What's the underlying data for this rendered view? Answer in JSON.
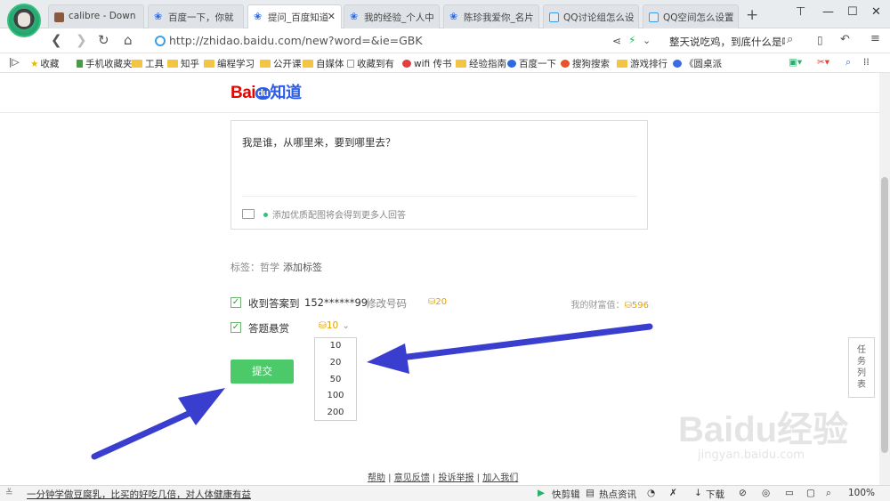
{
  "browser": {
    "tabs": [
      {
        "label": "calibre - Down",
        "icon": "book-icon",
        "active": false
      },
      {
        "label": "百度一下，你就",
        "icon": "baidu-paw-icon",
        "active": false
      },
      {
        "label": "提问_百度知道",
        "icon": "baidu-paw-icon",
        "active": true
      },
      {
        "label": "我的经验_个人中",
        "icon": "baidu-paw-icon",
        "active": false
      },
      {
        "label": "陈珍我爱你_名片",
        "icon": "baidu-paw-icon",
        "active": false
      },
      {
        "label": "QQ讨论组怎么设",
        "icon": "qq-icon",
        "active": false
      },
      {
        "label": "QQ空间怎么设置",
        "icon": "qq-icon",
        "active": false
      }
    ],
    "url": "http://zhidao.baidu.com/new?word=&ie=GBK",
    "search_query": "整天说吃鸡，到底什么是吃",
    "bookmarks": [
      "收藏",
      "手机收藏夹",
      "工具",
      "知乎",
      "编程学习",
      "公开课",
      "自媒体",
      "收藏到有",
      "wifi 传书",
      "经验指南",
      "百度一下",
      "搜狗搜索",
      "游戏排行",
      "《圆桌派"
    ]
  },
  "page": {
    "logo_text": "Bai",
    "logo_du": "du",
    "logo_zhidao": "知道",
    "question_text": "我是谁，从哪里来，要到哪里去？",
    "image_hint": "添加优质配图将会得到更多人回答",
    "tags_label": "标签：哲学",
    "add_tag": "添加标签",
    "receive_label": "收到答案到",
    "phone_masked": "152******99",
    "modify_phone": "修改号码",
    "receive_coin": "20",
    "wealth_label": "我的财富值：",
    "wealth_value": "596",
    "reward_label": "答题悬赏",
    "reward_selected": "10",
    "reward_options": [
      "10",
      "20",
      "50",
      "100",
      "200"
    ],
    "submit_label": "提交",
    "footer_links": [
      "帮助",
      "意见反馈",
      "投诉举报",
      "加入我们"
    ],
    "task_panel": "任务列表",
    "watermark_main": "Baidu经验",
    "watermark_sub": "jingyan.baidu.com"
  },
  "statusbar": {
    "news": "一分钟学做豆腐乳，比买的好吃几倍，对人体健康有益",
    "items": [
      "快剪辑",
      "热点资讯",
      "下载",
      "100%"
    ]
  },
  "colors": {
    "accent": "#4cc969",
    "annotation_arrow": "#3a3ecf",
    "coin": "#e0a100"
  }
}
